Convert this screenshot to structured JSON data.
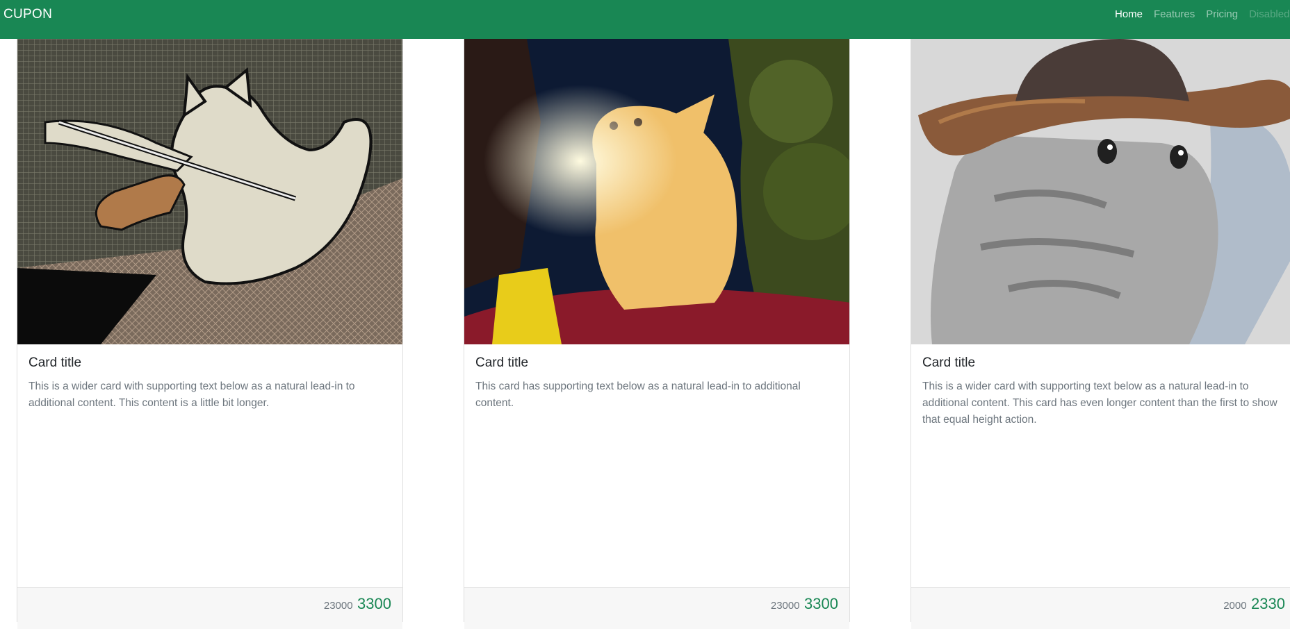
{
  "navbar": {
    "brand": "CUPON",
    "links": [
      {
        "label": "Home",
        "state": "active"
      },
      {
        "label": "Features",
        "state": "normal"
      },
      {
        "label": "Pricing",
        "state": "normal"
      },
      {
        "label": "Disabled",
        "state": "disabled"
      }
    ]
  },
  "cards": [
    {
      "image": "cat-playing-violin-illustration",
      "title": "Card title",
      "text": "This is a wider card with supporting text below as a natural lead-in to additional content. This content is a little bit longer.",
      "old_price": "23000",
      "new_price": "3300"
    },
    {
      "image": "orange-kitten-photo",
      "title": "Card title",
      "text": "This card has supporting text below as a natural lead-in to additional content.",
      "old_price": "23000",
      "new_price": "3300"
    },
    {
      "image": "kitten-in-cowboy-hat-photo",
      "title": "Card title",
      "text": "This is a wider card with supporting text below as a natural lead-in to additional content. This card has even longer content than the first to show that equal height action.",
      "old_price": "2000",
      "new_price": "2330"
    }
  ],
  "colors": {
    "primary": "#198754",
    "muted": "#6c757d",
    "footer_bg": "#f7f7f7"
  }
}
